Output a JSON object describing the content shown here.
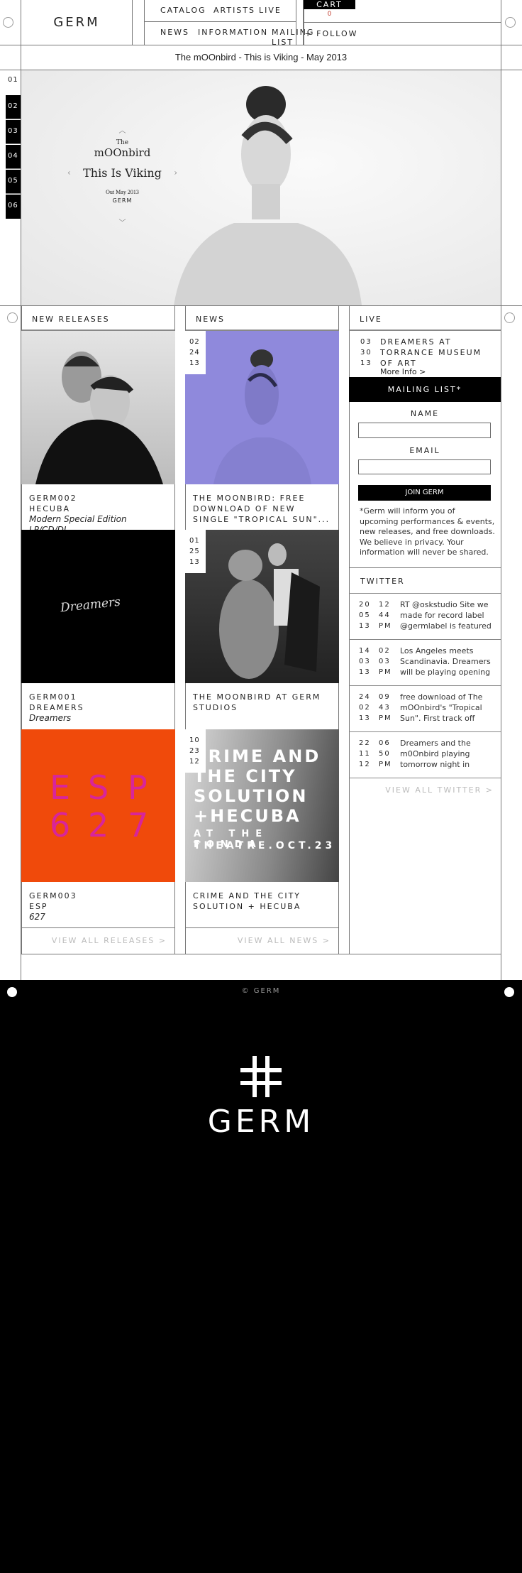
{
  "header": {
    "logo": "GERM",
    "nav_top": [
      "CATALOG",
      "ARTISTS",
      "LIVE"
    ],
    "nav_bottom": [
      "NEWS",
      "INFORMATION",
      "MAILING LIST"
    ],
    "cart_label": "CART",
    "cart_count": "0",
    "follow_label": "+ FOLLOW"
  },
  "banner": {
    "text": "The mOOnbird - This is Viking - May 2013"
  },
  "hero": {
    "slides": [
      "01",
      "02",
      "03",
      "04",
      "05",
      "06"
    ],
    "active_slide": "01",
    "the": "The",
    "artist": "mOOnbird",
    "title": "This Is Viking",
    "date": "Out May 2013",
    "label": "GERM"
  },
  "releases": {
    "heading": "NEW RELEASES",
    "items": [
      {
        "cat": "GERM002",
        "artist": "HECUBA",
        "title": "Modern Special Edition LP/CD/DL"
      },
      {
        "cat": "GERM001",
        "artist": "DREAMERS",
        "title": "Dreamers",
        "cover_text": "Dreamers"
      },
      {
        "cat": "GERM003",
        "artist": "ESP",
        "title": "627",
        "cover_letters": [
          "E",
          "S",
          "P",
          "6",
          "2",
          "7"
        ]
      }
    ],
    "view_all": "VIEW ALL RELEASES >"
  },
  "news": {
    "heading": "NEWS",
    "items": [
      {
        "date": [
          "02",
          "24",
          "13"
        ],
        "title": "THE MOONBIRD: FREE DOWNLOAD OF NEW SINGLE \"TROPICAL SUN\"..."
      },
      {
        "date": [
          "01",
          "25",
          "13"
        ],
        "title": "THE MOONBIRD AT GERM STUDIOS"
      },
      {
        "date": [
          "10",
          "23",
          "12"
        ],
        "title": "CRIME AND THE CITY SOLUTION + HECUBA",
        "poster_lines": [
          "CRIME AND",
          "THE CITY",
          "SOLUTION",
          "+HECUBA",
          "AT THE FONDA",
          "THEATRE.OCT.23"
        ]
      }
    ],
    "view_all": "VIEW ALL NEWS >"
  },
  "live": {
    "heading": "LIVE",
    "event": {
      "date": [
        "03",
        "30",
        "13"
      ],
      "title": "DREAMERS AT TORRANCE MUSEUM OF ART",
      "more": "More Info >"
    }
  },
  "mailing": {
    "heading": "MAILING LIST*",
    "name_label": "NAME",
    "email_label": "EMAIL",
    "name_value": "",
    "email_value": "",
    "join": "JOIN GERM",
    "note": "*Germ will inform you of upcoming performances & events, new releases, and free downloads. We believe in privacy. Your information will never be shared."
  },
  "twitter": {
    "heading": "TWITTER",
    "tweets": [
      {
        "date": [
          "20",
          "05",
          "13"
        ],
        "time": [
          "12",
          "44",
          "PM"
        ],
        "text": "RT @oskstudio Site we made for record label @germlabel is featured"
      },
      {
        "date": [
          "14",
          "03",
          "13"
        ],
        "time": [
          "02",
          "03",
          "PM"
        ],
        "text": "Los Angeles meets Scandinavia. Dreamers will be playing opening"
      },
      {
        "date": [
          "24",
          "02",
          "13"
        ],
        "time": [
          "09",
          "43",
          "PM"
        ],
        "text": "free download of The mOOnbird's \"Tropical Sun\". First track off"
      },
      {
        "date": [
          "22",
          "11",
          "12"
        ],
        "time": [
          "06",
          "50",
          "PM"
        ],
        "text": "Dreamers and the m0Onbird playing tomorrow night in"
      }
    ],
    "view_all": "VIEW ALL TWITTER >"
  },
  "footer": {
    "copyright": "© GERM",
    "logo_symbol": "#",
    "logo_text": "GERM"
  },
  "colors": {
    "purple": "#8f89dc",
    "orange": "#f04a0b",
    "magenta": "#d8259a",
    "cart_count": "#c0392b"
  }
}
